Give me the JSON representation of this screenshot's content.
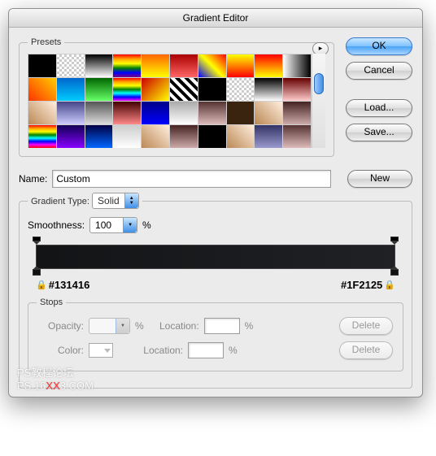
{
  "title": "Gradient Editor",
  "buttons": {
    "ok": "OK",
    "cancel": "Cancel",
    "load": "Load...",
    "save": "Save...",
    "new": "New",
    "delete": "Delete"
  },
  "presets": {
    "legend": "Presets",
    "swatches": [
      "#000000",
      "repeating-conic-gradient(#ccc 0 25%,#fff 0 50%) 0 0/6px 6px",
      "linear-gradient(#000,#fff)",
      "linear-gradient(red,orange,yellow,green,blue,purple)",
      "linear-gradient(#f60,#ff0)",
      "linear-gradient(#a00,#f66)",
      "linear-gradient(45deg,#00f,#ff0,#f00)",
      "linear-gradient(#ff0,#f00)",
      "linear-gradient(#f00,#ff0)",
      "linear-gradient(90deg,#fff,#000)",
      "linear-gradient(45deg,#f30,#fc0)",
      "linear-gradient(#06c,#0cf)",
      "linear-gradient(#060,#6f6)",
      "linear-gradient(red,orange,yellow,green,cyan,blue,magenta)",
      "linear-gradient(135deg,#c00,#ff0)",
      "repeating-linear-gradient(45deg,#000 0 4px,#fff 4px 8px)",
      "#000",
      "repeating-conic-gradient(#ccc 0 25%,#fff 0 50%) 0 0/6px 6px",
      "linear-gradient(#000,#fff)",
      "linear-gradient(#600,#fcc)",
      "linear-gradient(45deg,#b85,#fed)",
      "linear-gradient(#448,#ccf)",
      "linear-gradient(#555,#ddd)",
      "linear-gradient(#400,#f88)",
      "linear-gradient(#008,#00f)",
      "linear-gradient(#aaa,#fff)",
      "linear-gradient(#533,#dbb)",
      "#3a240f",
      "linear-gradient(45deg,#b85,#fed)",
      "linear-gradient(#422,#caa)",
      "linear-gradient(red,orange,yellow,green,cyan,blue,magenta,red)",
      "linear-gradient(#105,#80f)",
      "linear-gradient(#004,#06f)",
      "linear-gradient(#ccc,#fff)",
      "linear-gradient(45deg,#b85,#fed)",
      "linear-gradient(#422,#caa)",
      "#000",
      "linear-gradient(45deg,#b85,#fed)",
      "linear-gradient(#336,#99c)",
      "linear-gradient(#533,#dbb)"
    ]
  },
  "name": {
    "label": "Name:",
    "value": "Custom"
  },
  "gradient_type": {
    "legend": "Gradient Type:",
    "value": "Solid"
  },
  "smoothness": {
    "label": "Smoothness:",
    "value": "100",
    "unit": "%"
  },
  "gradient": {
    "left_hex": "#131416",
    "right_hex": "#1F2125"
  },
  "stops": {
    "legend": "Stops",
    "opacity_label": "Opacity:",
    "opacity_value": "",
    "opacity_unit": "%",
    "color_label": "Color:",
    "location_label": "Location:",
    "location_value": "",
    "location_unit": "%"
  },
  "watermark": {
    "line1": "PS教程论坛",
    "line2a": "PS.16",
    "line2b": "XX",
    "line2c": "3.COM"
  }
}
